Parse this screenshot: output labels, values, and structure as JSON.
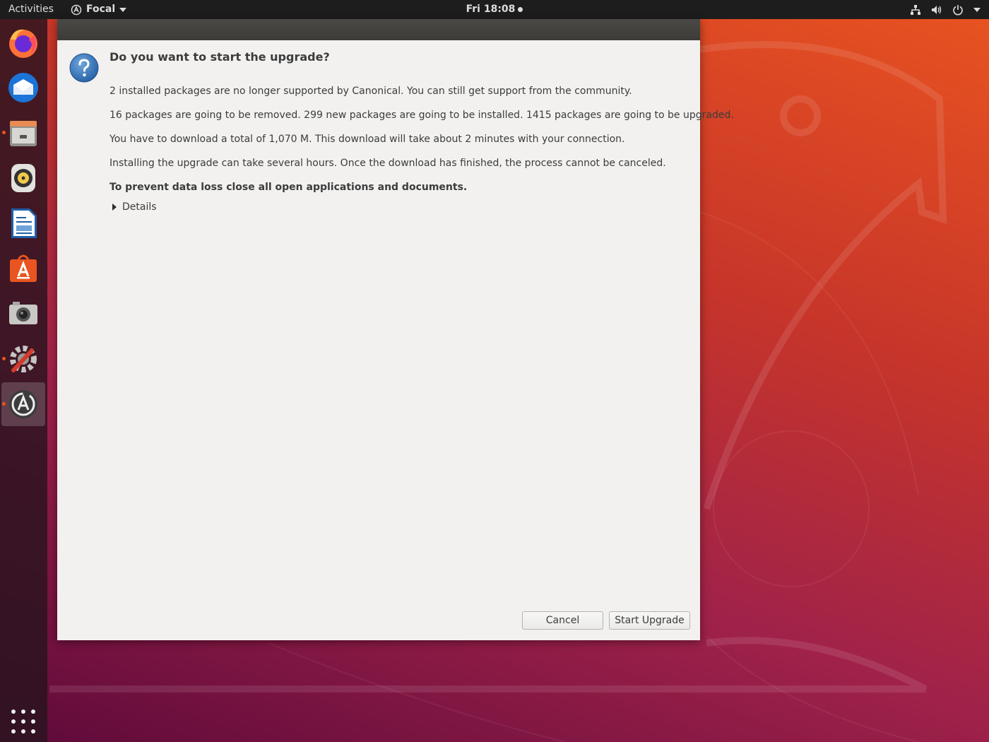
{
  "topbar": {
    "activities": "Activities",
    "app_name": "Focal",
    "clock": "Fri 18:08"
  },
  "dock": {
    "items": [
      {
        "name": "firefox",
        "icon": "firefox-icon"
      },
      {
        "name": "thunderbird",
        "icon": "thunderbird-icon"
      },
      {
        "name": "files",
        "icon": "files-icon"
      },
      {
        "name": "rhythmbox",
        "icon": "rhythmbox-icon"
      },
      {
        "name": "libreoffice-writer",
        "icon": "writer-icon"
      },
      {
        "name": "ubuntu-software",
        "icon": "software-icon"
      },
      {
        "name": "screenshot",
        "icon": "camera-icon"
      },
      {
        "name": "system-tools",
        "icon": "settings-tools-icon"
      },
      {
        "name": "software-updater",
        "icon": "updater-icon"
      }
    ]
  },
  "dialog": {
    "heading": "Do you want to start the upgrade?",
    "messages": {
      "unsupported": "2 installed packages are no longer supported by Canonical. You can still get support from the community.",
      "packages": "16 packages are going to be removed. 299 new packages are going to be installed. 1415 packages are going to be upgraded.",
      "download": "You have to download a total of 1,070 M. This download will take about 2 minutes with your connection.",
      "duration": "Installing the upgrade can take several hours. Once the download has finished, the process cannot be canceled.",
      "warning": "To prevent data loss close all open applications and documents."
    },
    "details_label": "Details",
    "cancel_label": "Cancel",
    "start_label": "Start Upgrade"
  },
  "colors": {
    "accent": "#e95420",
    "dialog_bg": "#f2f1f0",
    "text": "#3c3c3c"
  }
}
